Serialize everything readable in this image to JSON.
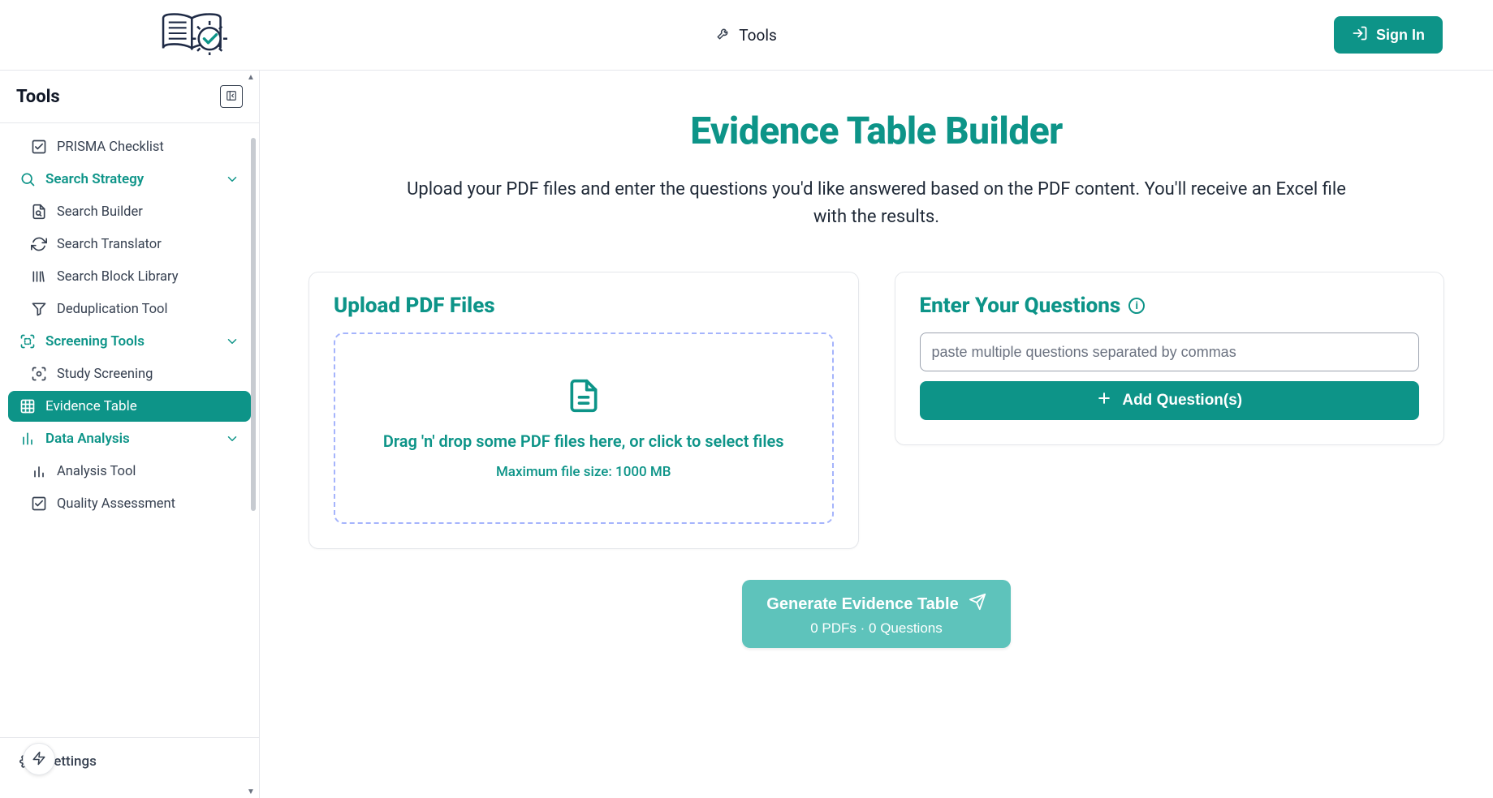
{
  "header": {
    "nav_label": "Tools",
    "signin_label": "Sign In"
  },
  "sidebar": {
    "title": "Tools",
    "top_item": {
      "label": "PRISMA Checklist"
    },
    "groups": [
      {
        "id": "search-strategy",
        "label": "Search Strategy",
        "expanded": true,
        "items": [
          {
            "label": "Search Builder"
          },
          {
            "label": "Search Translator"
          },
          {
            "label": "Search Block Library"
          },
          {
            "label": "Deduplication Tool"
          }
        ]
      },
      {
        "id": "screening-tools",
        "label": "Screening Tools",
        "expanded": true,
        "items": [
          {
            "label": "Study Screening"
          }
        ]
      }
    ],
    "active_item": {
      "label": "Evidence Table"
    },
    "group_after": {
      "id": "data-analysis",
      "label": "Data Analysis",
      "expanded": true,
      "items": [
        {
          "label": "Analysis Tool"
        },
        {
          "label": "Quality Assessment"
        }
      ]
    },
    "bottom_item": {
      "label": "Settings"
    }
  },
  "main": {
    "title": "Evidence Table Builder",
    "description": "Upload your PDF files and enter the questions you'd like answered based on the PDF content. You'll receive an Excel file with the results.",
    "upload_title": "Upload PDF Files",
    "drop_text": "Drag 'n' drop some PDF files here, or click to select files",
    "drop_sub": "Maximum file size: 1000 MB",
    "questions_title": "Enter Your Questions",
    "questions_placeholder": "paste multiple questions separated by commas",
    "add_question_label": "Add Question(s)",
    "generate_label": "Generate Evidence Table",
    "generate_sub": "0 PDFs · 0 Questions"
  },
  "colors": {
    "accent": "#0d9488"
  }
}
